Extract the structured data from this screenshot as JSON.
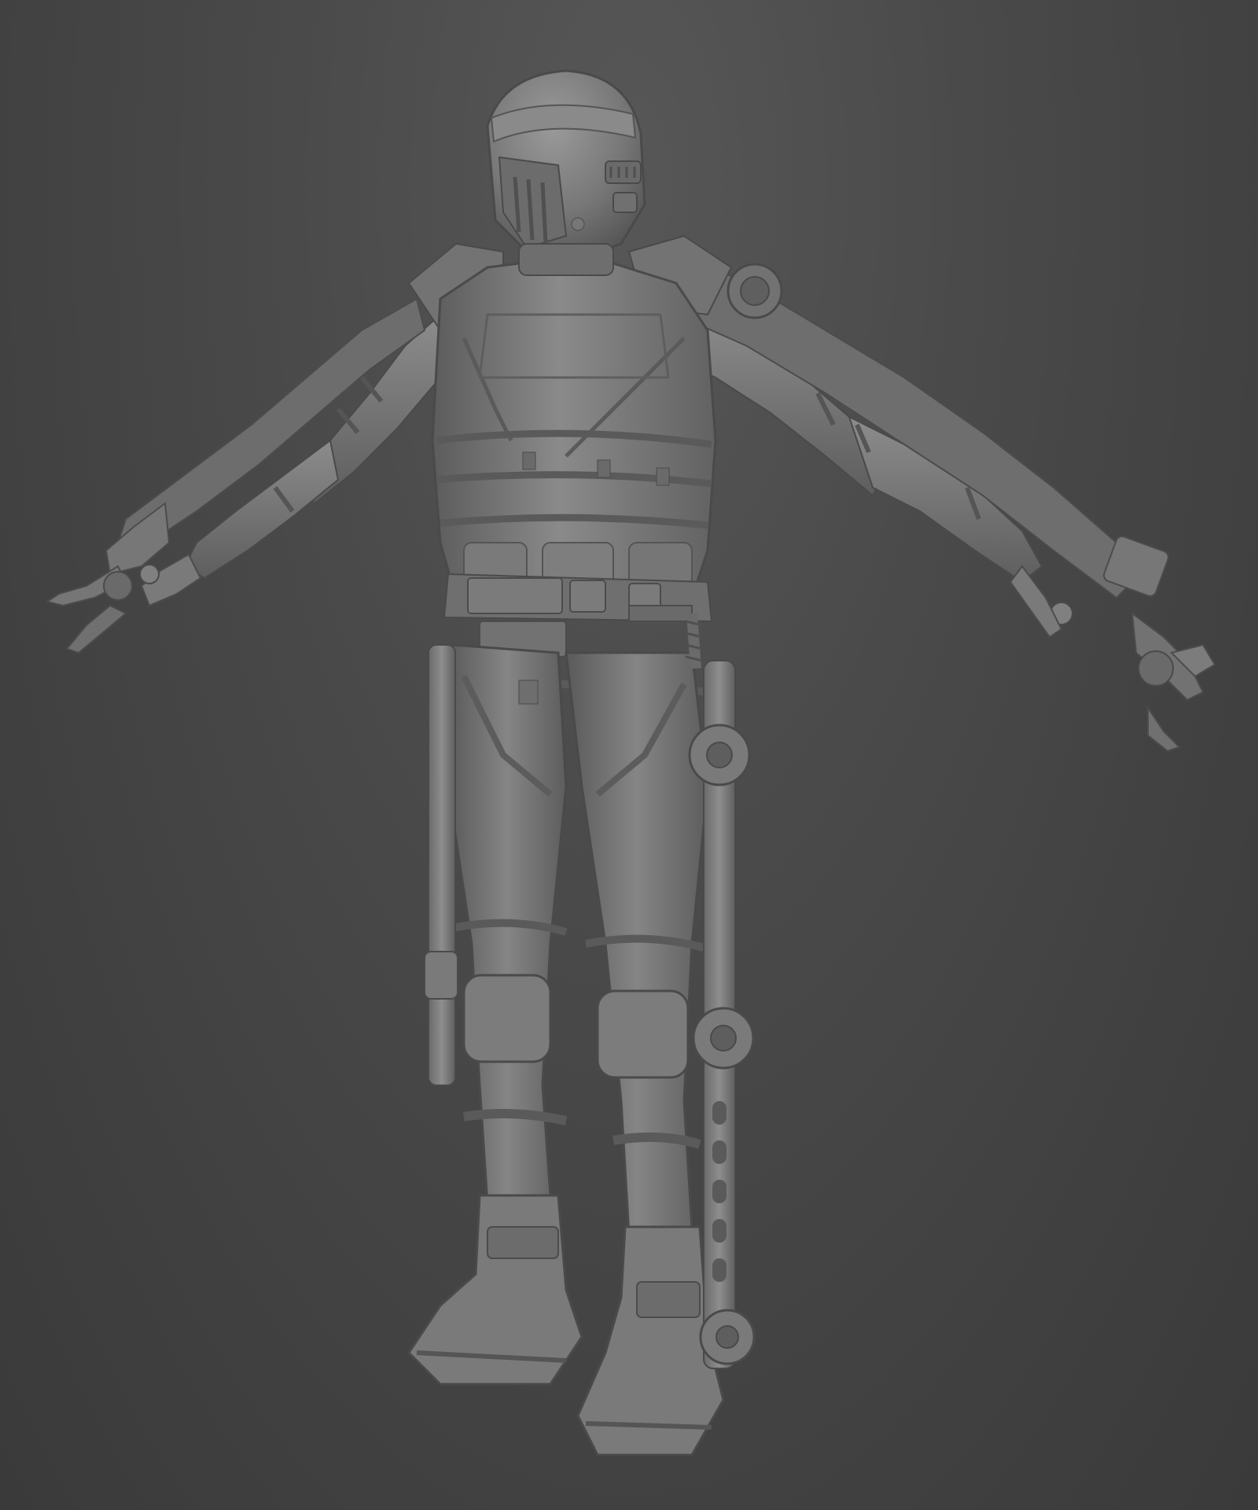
{
  "scene": {
    "background_color": "#484848",
    "model_color": "#7a7a7a",
    "shadow_color": "#4f4f4f",
    "highlight_color": "#9a9a9a",
    "subject": "armored-exosuit-figure",
    "pose": "t-pose"
  }
}
